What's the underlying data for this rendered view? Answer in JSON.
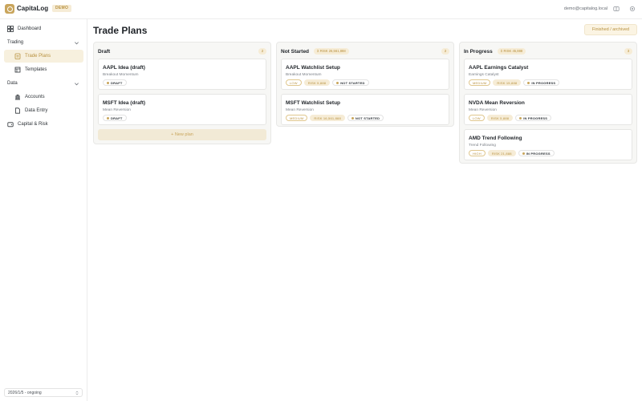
{
  "app": {
    "brand": "CapitaLog",
    "demo_badge": "DEMO",
    "user_email": "demo@capitalog.local"
  },
  "sidebar": {
    "dashboard": "Dashboard",
    "trading_group": "Trading",
    "trade_plans": "Trade Plans",
    "templates": "Templates",
    "data_group": "Data",
    "accounts": "Accounts",
    "data_entry": "Data Entry",
    "capital_risk": "Capital & Risk",
    "period_select": "2026/1/5 - ongoing"
  },
  "main": {
    "title": "Trade Plans",
    "finished_button": "Finished / archived",
    "columns": [
      {
        "title": "Draft",
        "total": "",
        "count": "2",
        "new_plan": "+ New plan",
        "cards": [
          {
            "title": "AAPL Idea (draft)",
            "strategy": "Breakout Momentum",
            "tags": [],
            "status": "DRAFT"
          },
          {
            "title": "MSFT Idea (draft)",
            "strategy": "Mean Reversion",
            "tags": [],
            "status": "DRAFT"
          }
        ]
      },
      {
        "title": "Not Started",
        "total": "Σ RISK 26,561,888",
        "count": "2",
        "cards": [
          {
            "title": "AAPL Watchlist Setup",
            "strategy": "Breakout Momentum",
            "tags": [
              "LOW",
              "RISK 5,888"
            ],
            "status": "NOT STARTED"
          },
          {
            "title": "MSFT Watchlist Setup",
            "strategy": "Mean Reversion",
            "tags": [
              "MEDIUM",
              "RISK 16,561,888"
            ],
            "status": "NOT STARTED"
          }
        ]
      },
      {
        "title": "In Progress",
        "total": "Σ RISK 45,888",
        "count": "3",
        "cards": [
          {
            "title": "AAPL Earnings Catalyst",
            "strategy": "Earnings Catalyst",
            "tags": [
              "MEDIUM",
              "RISK 15,888"
            ],
            "status": "IN PROGRESS"
          },
          {
            "title": "NVDA Mean Reversion",
            "strategy": "Mean Reversion",
            "tags": [
              "LOW",
              "RISK 5,888"
            ],
            "status": "IN PROGRESS"
          },
          {
            "title": "AMD Trend Following",
            "strategy": "Trend Following",
            "tags": [
              "HIGH",
              "RISK 21,888"
            ],
            "status": "IN PROGRESS"
          }
        ]
      }
    ]
  }
}
